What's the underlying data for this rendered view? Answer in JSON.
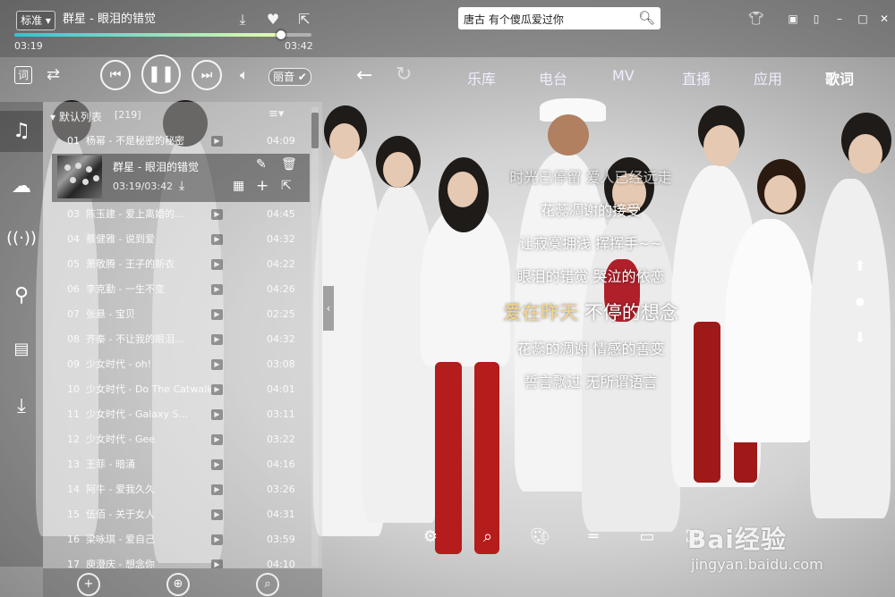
{
  "header": {
    "quality": "标准",
    "song_title": "群星 - 眼泪的错觉",
    "time_current": "03:19",
    "time_total": "03:42",
    "progress_fraction": 0.898
  },
  "search": {
    "value": "唐古 有个傻瓜爱过你"
  },
  "controls": {
    "sound_effect": "丽音"
  },
  "nav": {
    "tabs": [
      "乐库",
      "电台",
      "MV",
      "直播",
      "应用",
      "歌词"
    ],
    "active_index": 5
  },
  "playlist": {
    "name": "默认列表",
    "count": "[219]",
    "rows": [
      {
        "no": "01",
        "title": "杨幂 - 不是秘密的秘密",
        "duration": "04:09"
      },
      {
        "no": "03",
        "title": "陈玉建 - 爱上离婚的…",
        "duration": "04:45"
      },
      {
        "no": "04",
        "title": "蔡健雅 - 说到爱",
        "duration": "04:32"
      },
      {
        "no": "05",
        "title": "萧敬腾 - 王子的新衣",
        "duration": "04:22"
      },
      {
        "no": "06",
        "title": "李克勤 - 一生不变",
        "duration": "04:26"
      },
      {
        "no": "07",
        "title": "张悬 - 宝贝",
        "duration": "02:25"
      },
      {
        "no": "08",
        "title": "齐秦 - 不让我的眼泪…",
        "duration": "04:32"
      },
      {
        "no": "09",
        "title": "少女时代 - oh!",
        "duration": "03:08"
      },
      {
        "no": "10",
        "title": "少女时代 - Do The Catwalk",
        "duration": "04:01"
      },
      {
        "no": "11",
        "title": "少女时代 - Galaxy S…",
        "duration": "03:11"
      },
      {
        "no": "12",
        "title": "少女时代 - Gee",
        "duration": "03:22"
      },
      {
        "no": "13",
        "title": "王菲 - 暗涌",
        "duration": "04:16"
      },
      {
        "no": "14",
        "title": "阿牛 - 爱我久久",
        "duration": "03:26"
      },
      {
        "no": "15",
        "title": "伍佰 - 关于女人",
        "duration": "04:31"
      },
      {
        "no": "16",
        "title": "梁咏琪 - 爱自己",
        "duration": "03:59"
      },
      {
        "no": "17",
        "title": "庾澄庆 - 想念你",
        "duration": "04:10"
      }
    ],
    "now_playing": {
      "title": "群星 - 眼泪的错觉",
      "time": "03:19/03:42"
    }
  },
  "lyrics": {
    "lines": [
      "时光已停留 爱人已经远走",
      "花蕊凋谢的接受",
      "让寂寞拥浅 挥挥手~~",
      "眼泪的错觉 哭泣的依恋",
      "不停的想念",
      "花蕊的凋谢 情感的善变",
      "誓言飘过 无所谓语言"
    ],
    "current_sung": "爱在昨天",
    "current_index": 4
  },
  "watermark": {
    "brand": "Bai经验",
    "url": "jingyan.baidu.com"
  },
  "colors": {
    "accent_lyric": "#f5d58a",
    "progress_start": "#2ec2d8",
    "progress_end": "#e8ffaa"
  }
}
